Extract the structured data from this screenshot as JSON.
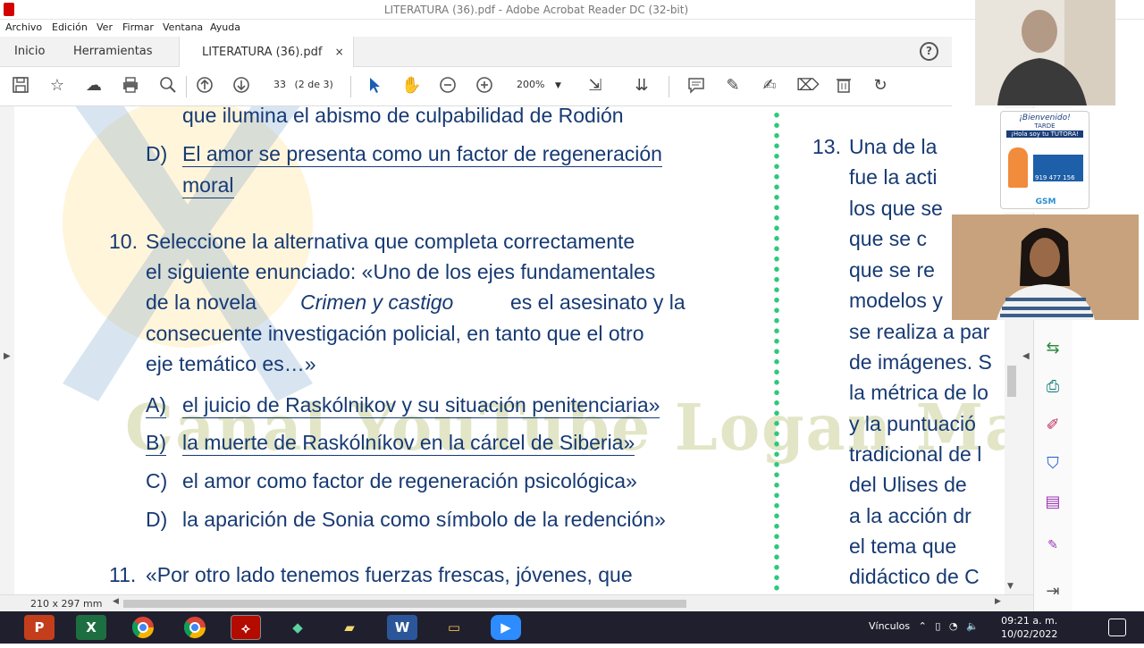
{
  "window": {
    "title": "LITERATURA (36).pdf - Adobe Acrobat Reader DC (32-bit)"
  },
  "menu": [
    "Archivo",
    "Edición",
    "Ver",
    "Firmar",
    "Ventana",
    "Ayuda"
  ],
  "tabs": {
    "home": "Inicio",
    "tools": "Herramientas",
    "document": "LITERATURA (36).pdf",
    "close": "×"
  },
  "help_label": "?",
  "toolbar": {
    "page_number": "33",
    "page_of": "(2 de 3)",
    "zoom": "200%"
  },
  "document": {
    "top_line": "que ilumina el abismo de culpabilidad de Rodión",
    "prev_option_d_letter": "D)",
    "prev_option_d_text": "El amor se presenta como un factor de regeneración",
    "prev_option_d_text2": "moral",
    "q10_number": "10.",
    "q10_lines": [
      "Seleccione la alternativa que completa correctamente",
      "el siguiente enunciado: «Uno de los ejes fundamentales",
      "de la novela",
      "Crimen y castigo",
      "es el asesinato y la",
      "consecuente investigación policial, en tanto que el otro",
      "eje temático es…»"
    ],
    "q10_options": [
      {
        "letter": "A)",
        "text": "el juicio de Raskólnikov y su situación penitenciaria»"
      },
      {
        "letter": "B)",
        "text": "la muerte de Raskólníkov en la cárcel de Siberia»"
      },
      {
        "letter": "C)",
        "text": "el amor como factor de regeneración psicológica»"
      },
      {
        "letter": "D)",
        "text": "la aparición de Sonia como símbolo de la redención»"
      }
    ],
    "q11_number": "11.",
    "q11_text": "«Por otro lado tenemos fuerzas frescas, jóvenes, que",
    "watermark": "Canal YouTube Logan Mathis",
    "q13_number": "13.",
    "right_lines": [
      "Una de la",
      "fue la acti",
      "los que se",
      "que se c",
      "que se re",
      "modelos y",
      "se realiza a par",
      "de imágenes. S",
      "la métrica de lo",
      "y la puntuació",
      "tradicional de l",
      "del Ulises de",
      "a la acción dr",
      "el tema que",
      "didáctico de C"
    ]
  },
  "status_bar": {
    "page_size": "210 x 297 mm"
  },
  "webcam_banner": {
    "line1": "¡Bienvenido!",
    "line2": "TARDE",
    "line3": "¡Hola soy tu TUTORA!",
    "phone": "919 477 156",
    "brand": "GSM"
  },
  "taskbar": {
    "tray_label": "Vínculos",
    "time": "09:21 a. m.",
    "date": "10/02/2022"
  },
  "colors": {
    "doc_text": "#173a73",
    "dots": "#2dc97a",
    "acrobat_red": "#d40000",
    "taskbar": "#1f1f2e"
  }
}
